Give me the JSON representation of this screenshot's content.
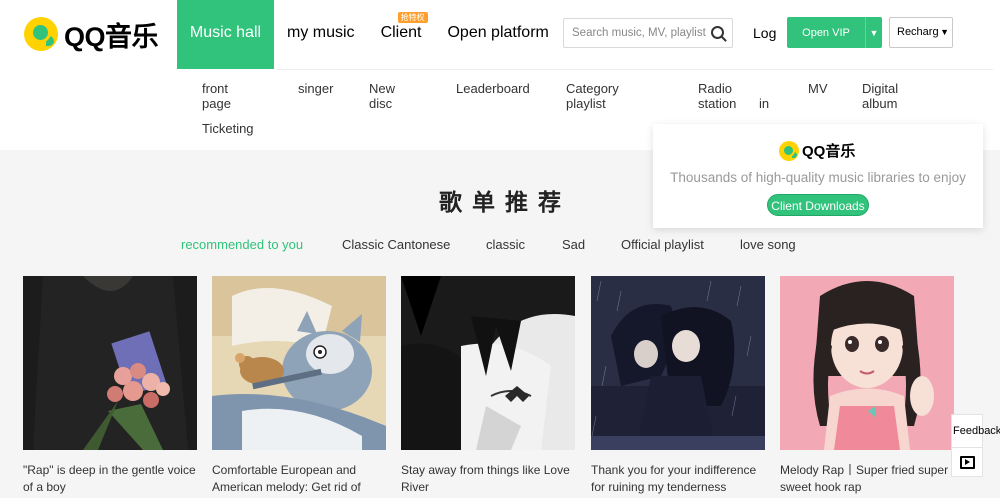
{
  "brand": {
    "name": "QQ音乐"
  },
  "nav": {
    "items": [
      {
        "label": "Music hall",
        "active": true
      },
      {
        "label": "my music"
      },
      {
        "label": "Client",
        "badge": "抢特权"
      },
      {
        "label": "Open platform"
      }
    ]
  },
  "search": {
    "placeholder": "Search music, MV, playlist"
  },
  "header": {
    "login": "Log",
    "vip": "Open VIP",
    "recharge": "Recharge"
  },
  "subnav": [
    "front page",
    "singer",
    "New disc",
    "Leaderboard",
    "Category playlist",
    "Radio station",
    "in",
    "MV",
    "Digital album",
    "Ticketing"
  ],
  "popover": {
    "brand": "QQ音乐",
    "desc": "Thousands of high-quality music libraries to enjoy",
    "button": "Client Downloads"
  },
  "section": {
    "title": "歌单推荐",
    "categories": [
      "recommended to you",
      "Classic Cantonese",
      "classic",
      "Sad",
      "Official playlist",
      "love song"
    ],
    "active_category": "recommended to you"
  },
  "playlists": [
    {
      "caption_1": "\"Rap\" is deep in the gentle voice",
      "caption_2": "of a boy",
      "cover_art": "man-with-roses"
    },
    {
      "caption_1": "Comfortable European and",
      "caption_2": "American melody: Get rid of",
      "cover_art": "tom-and-jerry"
    },
    {
      "caption_1": "Stay away from things like Love",
      "caption_2": "River",
      "cover_art": "anime-boy-monochrome"
    },
    {
      "caption_1": "Thank you for your indifference",
      "caption_2": "for ruining my tenderness",
      "cover_art": "anime-couple-rain"
    },
    {
      "caption_1": "Melody Rap丨Super fried super",
      "caption_2": "sweet hook rap",
      "cover_art": "anime-girl-braids"
    }
  ],
  "sidebar": {
    "feedback": "Feedback"
  },
  "colors": {
    "accent": "#31c27c",
    "badge": "#ff9f2d",
    "logo_yellow": "#ffd200"
  }
}
